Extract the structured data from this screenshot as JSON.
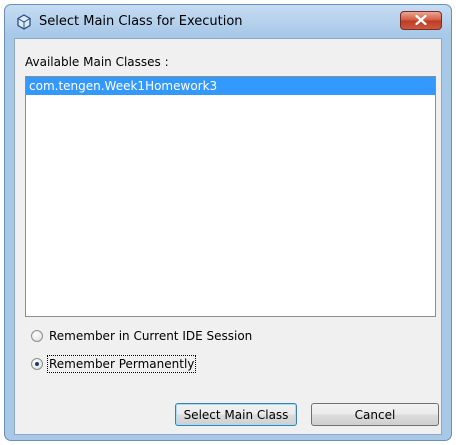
{
  "window": {
    "title": "Select Main Class for Execution"
  },
  "list": {
    "label": "Available Main Classes :",
    "items": [
      {
        "label": "com.tengen.Week1Homework3",
        "selected": true
      }
    ]
  },
  "options": [
    {
      "label": "Remember in Current IDE Session",
      "checked": false
    },
    {
      "label": "Remember Permanently",
      "checked": true
    }
  ],
  "buttons": {
    "select": "Select Main Class",
    "cancel": "Cancel"
  },
  "colors": {
    "selection": "#3399ff",
    "close_button": "#c95a40"
  },
  "icons": {
    "app": "hexagon-app-icon",
    "close": "close-x-icon"
  }
}
